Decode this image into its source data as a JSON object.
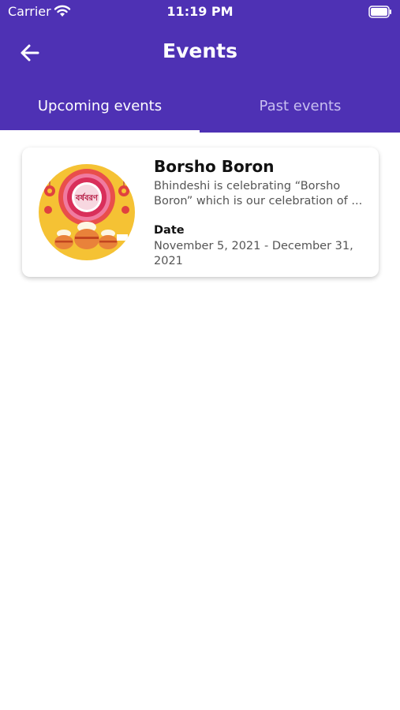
{
  "status_bar": {
    "carrier": "Carrier",
    "time": "11:19 PM",
    "wifi_icon": "wifi-icon",
    "battery_icon": "battery-icon"
  },
  "nav": {
    "back_icon": "arrow-left-icon",
    "title": "Events"
  },
  "tabs": [
    {
      "label": "Upcoming events",
      "active": true
    },
    {
      "label": "Past events",
      "active": false
    }
  ],
  "events": [
    {
      "title": "Borsho Boron",
      "description": "Bhindeshi is celebrating “Borsho Boron” which is our celebration of ...",
      "date_label": "Date",
      "date_value": "November 5, 2021 - December 31, 2021",
      "image_text": "বর্ষবরণ"
    }
  ],
  "colors": {
    "header_bg": "#4e31b4",
    "tab_inactive": "#c8bff0",
    "image_bg": "#f5c234"
  }
}
